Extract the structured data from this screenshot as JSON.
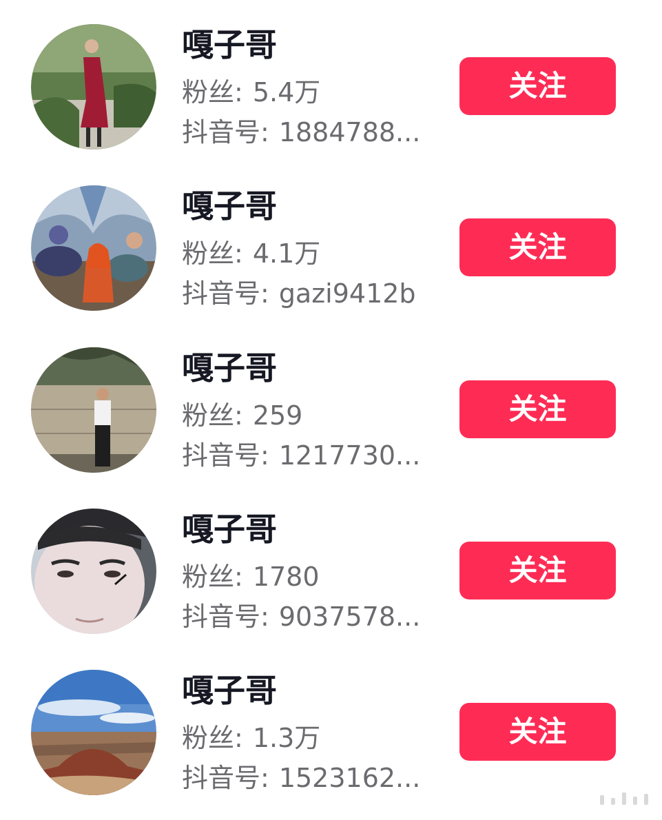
{
  "users": [
    {
      "name": "嘎子哥",
      "fans_label": "粉丝:",
      "fans_value": "5.4万",
      "id_label": "抖音号:",
      "id_value": "1884788...",
      "follow_label": "关注",
      "avatar_icon": "avatar-woman-red-dress"
    },
    {
      "name": "嘎子哥",
      "fans_label": "粉丝:",
      "fans_value": "4.1万",
      "id_label": "抖音号:",
      "id_value": "gazi9412b",
      "follow_label": "关注",
      "avatar_icon": "avatar-anime-bikers"
    },
    {
      "name": "嘎子哥",
      "fans_label": "粉丝:",
      "fans_value": "259",
      "id_label": "抖音号:",
      "id_value": "1217730...",
      "follow_label": "关注",
      "avatar_icon": "avatar-man-by-wall"
    },
    {
      "name": "嘎子哥",
      "fans_label": "粉丝:",
      "fans_value": "1780",
      "id_label": "抖音号:",
      "id_value": "9037578...",
      "follow_label": "关注",
      "avatar_icon": "avatar-face-closeup"
    },
    {
      "name": "嘎子哥",
      "fans_label": "粉丝:",
      "fans_value": "1.3万",
      "id_label": "抖音号:",
      "id_value": "1523162...",
      "follow_label": "关注",
      "avatar_icon": "avatar-landscape-mountain"
    }
  ],
  "colors": {
    "follow_button": "#fe2c55",
    "name_text": "#161823",
    "meta_text": "#6b6b6f"
  }
}
